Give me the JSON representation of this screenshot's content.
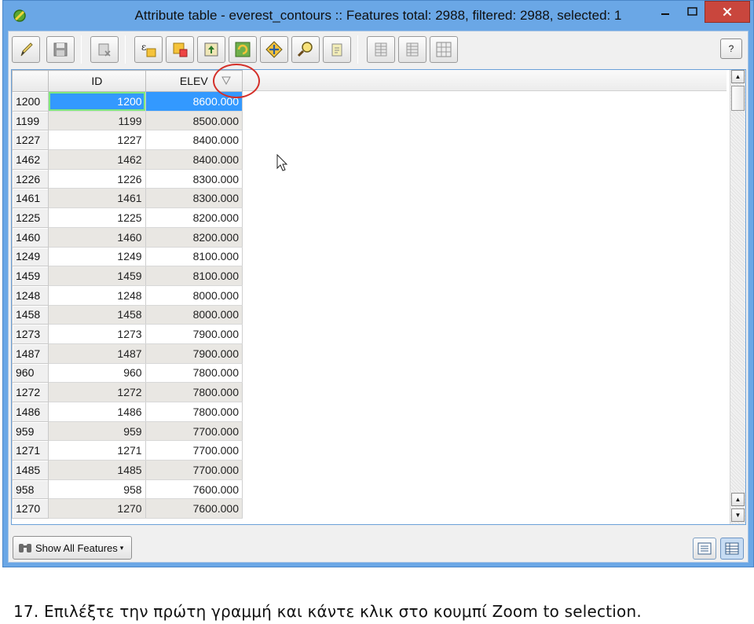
{
  "window": {
    "title": "Attribute table - everest_contours :: Features total: 2988, filtered: 2988, selected: 1"
  },
  "toolbar": {
    "buttons": [
      {
        "name": "toggle-editing-icon"
      },
      {
        "name": "save-edits-icon"
      },
      {
        "name": "delete-selected-icon"
      },
      {
        "name": "select-by-expression-icon"
      },
      {
        "name": "unselect-all-icon"
      },
      {
        "name": "move-selection-to-top-icon"
      },
      {
        "name": "invert-selection-icon"
      },
      {
        "name": "pan-map-to-selection-icon"
      },
      {
        "name": "zoom-to-selection-icon"
      },
      {
        "name": "copy-rows-icon"
      },
      {
        "name": "new-column-icon"
      },
      {
        "name": "delete-column-icon"
      },
      {
        "name": "field-calculator-icon"
      }
    ],
    "help_label": "?"
  },
  "table": {
    "columns": [
      "ID",
      "ELEV"
    ],
    "rows": [
      {
        "row": "1200",
        "id": "1200",
        "elev": "8600.000"
      },
      {
        "row": "1199",
        "id": "1199",
        "elev": "8500.000"
      },
      {
        "row": "1227",
        "id": "1227",
        "elev": "8400.000"
      },
      {
        "row": "1462",
        "id": "1462",
        "elev": "8400.000"
      },
      {
        "row": "1226",
        "id": "1226",
        "elev": "8300.000"
      },
      {
        "row": "1461",
        "id": "1461",
        "elev": "8300.000"
      },
      {
        "row": "1225",
        "id": "1225",
        "elev": "8200.000"
      },
      {
        "row": "1460",
        "id": "1460",
        "elev": "8200.000"
      },
      {
        "row": "1249",
        "id": "1249",
        "elev": "8100.000"
      },
      {
        "row": "1459",
        "id": "1459",
        "elev": "8100.000"
      },
      {
        "row": "1248",
        "id": "1248",
        "elev": "8000.000"
      },
      {
        "row": "1458",
        "id": "1458",
        "elev": "8000.000"
      },
      {
        "row": "1273",
        "id": "1273",
        "elev": "7900.000"
      },
      {
        "row": "1487",
        "id": "1487",
        "elev": "7900.000"
      },
      {
        "row": "960",
        "id": "960",
        "elev": "7800.000"
      },
      {
        "row": "1272",
        "id": "1272",
        "elev": "7800.000"
      },
      {
        "row": "1486",
        "id": "1486",
        "elev": "7800.000"
      },
      {
        "row": "959",
        "id": "959",
        "elev": "7700.000"
      },
      {
        "row": "1271",
        "id": "1271",
        "elev": "7700.000"
      },
      {
        "row": "1485",
        "id": "1485",
        "elev": "7700.000"
      },
      {
        "row": "958",
        "id": "958",
        "elev": "7600.000"
      },
      {
        "row": "1270",
        "id": "1270",
        "elev": "7600.000"
      }
    ],
    "selected_row": "1200",
    "sort_column": "ELEV",
    "sort_order": "descending"
  },
  "bottom": {
    "show_features_label": "Show All Features"
  },
  "caption": "17. Επιλέξτε την πρώτη γραμμή και κάντε κλικ στο κουμπί Zoom to selection.",
  "colors": {
    "titlebar": "#6aa7e6",
    "selection": "#3399ff",
    "close_button": "#c9463d",
    "annotation_circle": "#d4302a"
  }
}
